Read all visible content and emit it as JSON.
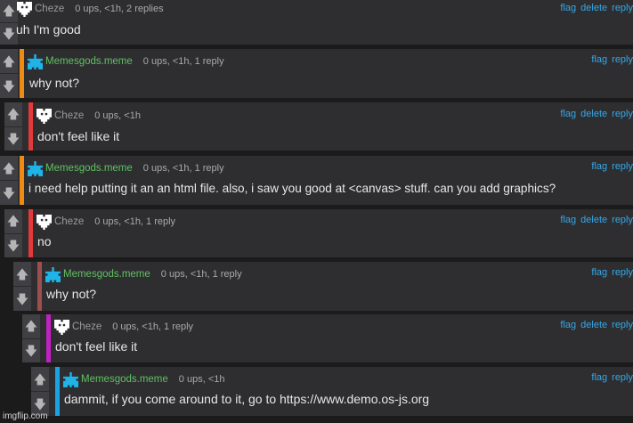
{
  "comments": [
    {
      "user": "Cheze",
      "meta": "0 ups, <1h, 2 replies",
      "text": "uh I'm good",
      "actions": [
        "flag",
        "delete",
        "reply"
      ]
    },
    {
      "user": "Memesgods.meme",
      "meta": "0 ups, <1h, 1 reply",
      "text": "why not?",
      "actions": [
        "flag",
        "reply"
      ]
    },
    {
      "user": "Cheze",
      "meta": "0 ups, <1h",
      "text": "don't feel like it",
      "actions": [
        "flag",
        "delete",
        "reply"
      ]
    },
    {
      "user": "Memesgods.meme",
      "meta": "0 ups, <1h, 1 reply",
      "text": "i need help putting it an an html file. also, i saw you good at <canvas> stuff. can you add graphics?",
      "actions": [
        "flag",
        "reply"
      ]
    },
    {
      "user": "Cheze",
      "meta": "0 ups, <1h, 1 reply",
      "text": "no",
      "actions": [
        "flag",
        "delete",
        "reply"
      ]
    },
    {
      "user": "Memesgods.meme",
      "meta": "0 ups, <1h, 1 reply",
      "text": "why not?",
      "actions": [
        "flag",
        "reply"
      ]
    },
    {
      "user": "Cheze",
      "meta": "0 ups, <1h, 1 reply",
      "text": "don't feel like it",
      "actions": [
        "flag",
        "delete",
        "reply"
      ]
    },
    {
      "user": "Memesgods.meme",
      "meta": "0 ups, <1h",
      "text": "dammit, if you come around to it, go to https://www.demo.os-js.org",
      "actions": [
        "flag",
        "reply"
      ]
    }
  ],
  "vote": {
    "up": "🡅",
    "down": "🡇"
  },
  "icons": {
    "cheze_avatar": "heart-pixel-icon",
    "memes_avatar": "cross-pixel-icon"
  },
  "colors": {
    "thread": [
      "#2e2e31",
      "#ef8b12",
      "#e23a3a",
      "#ef8b12",
      "#e23a3a",
      "#9b4f4f",
      "#c221c2",
      "#1aa3e3"
    ]
  },
  "watermark": "imgflip.com"
}
